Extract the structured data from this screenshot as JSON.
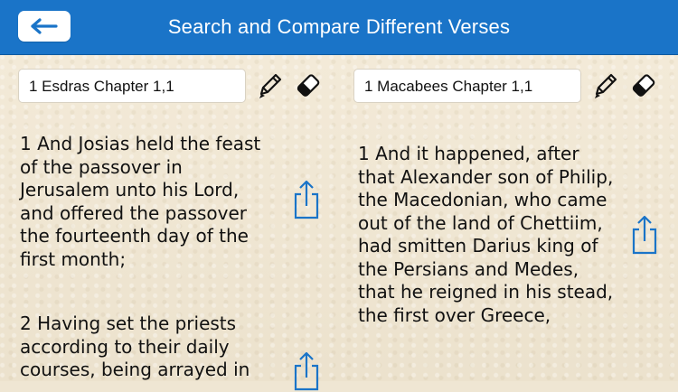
{
  "header": {
    "title": "Search and Compare Different Verses",
    "back_icon": "back-arrow-icon"
  },
  "colors": {
    "header_bg": "#1a74c8",
    "accent": "#1a74c8",
    "paper": "#efe6d3"
  },
  "left": {
    "reference": "1 Esdras Chapter 1,1",
    "verses": [
      "1 And Josias held the feast\nof the passover in\nJerusalem unto his Lord,\nand offered the passover\nthe fourteenth day of the\nfirst month;",
      "2 Having set the priests\naccording to their daily\ncourses, being arrayed in"
    ]
  },
  "right": {
    "reference": "1 Macabees Chapter 1,1",
    "verses": [
      "1 And it happened, after\nthat Alexander son of Philip,\nthe Macedonian, who came\nout of the land of Chettiim,\nhad smitten Darius king of\nthe Persians and Medes,\nthat he reigned in his stead,\nthe first over Greece,"
    ]
  },
  "icons": {
    "edit": "pencil-icon",
    "clear": "eraser-icon",
    "share": "share-icon"
  }
}
